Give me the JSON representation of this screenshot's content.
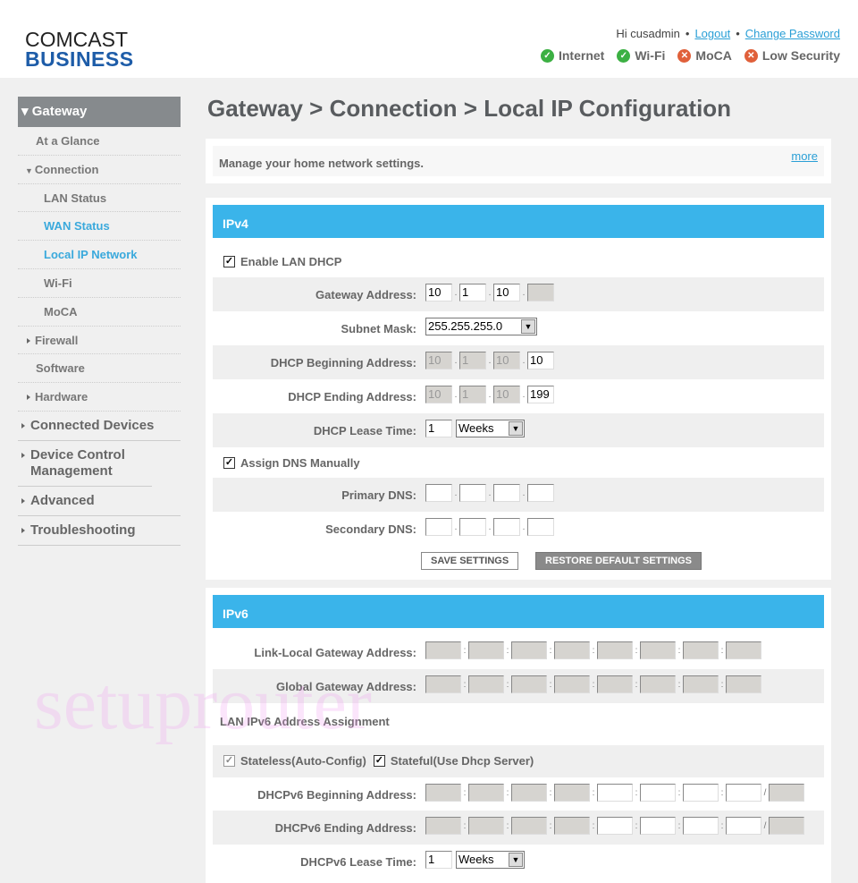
{
  "header": {
    "logo_line1": "COMCAST",
    "logo_line2": "BUSINESS",
    "greeting": "Hi cusadmin",
    "logout": "Logout",
    "change_password": "Change Password",
    "status": [
      {
        "label": "Internet",
        "state": "ok"
      },
      {
        "label": "Wi-Fi",
        "state": "ok"
      },
      {
        "label": "MoCA",
        "state": "error"
      },
      {
        "label": "Low Security",
        "state": "error"
      }
    ]
  },
  "colors": {
    "ok": "#3cb043",
    "error": "#e0603a",
    "accent": "#3ab4ea",
    "sidebar_active": "#868a8d"
  },
  "sidebar": {
    "top": "Gateway",
    "items": [
      {
        "label": "At a Glance",
        "level": 1
      },
      {
        "label": "Connection",
        "level": 1,
        "open": true
      },
      {
        "label": "LAN Status",
        "level": 2
      },
      {
        "label": "WAN Status",
        "level": 2,
        "active": true
      },
      {
        "label": "Local IP Network",
        "level": 2,
        "active": true
      },
      {
        "label": "Wi-Fi",
        "level": 2
      },
      {
        "label": "MoCA",
        "level": 2
      },
      {
        "label": "Firewall",
        "level": 1,
        "collapsed": true
      },
      {
        "label": "Software",
        "level": 1
      },
      {
        "label": "Hardware",
        "level": 1,
        "collapsed": true
      }
    ],
    "sections": [
      "Connected Devices",
      "Device Control Management",
      "Advanced",
      "Troubleshooting"
    ]
  },
  "page": {
    "title": "Gateway > Connection > Local IP Configuration",
    "intro": "Manage your home network settings.",
    "more": "more"
  },
  "ipv4": {
    "title": "IPv4",
    "enable_dhcp": "Enable LAN DHCP",
    "gateway_label": "Gateway Address:",
    "gateway": [
      "10",
      "1",
      "10",
      ""
    ],
    "subnet_label": "Subnet Mask:",
    "subnet": "255.255.255.0",
    "begin_label": "DHCP Beginning Address:",
    "begin": [
      "10",
      "1",
      "10",
      "10"
    ],
    "end_label": "DHCP Ending Address:",
    "end": [
      "10",
      "1",
      "10",
      "199"
    ],
    "lease_label": "DHCP Lease Time:",
    "lease": "1",
    "lease_unit": "Weeks",
    "assign_dns": "Assign DNS Manually",
    "primary_label": "Primary DNS:",
    "secondary_label": "Secondary DNS:",
    "save": "SAVE SETTINGS",
    "restore": "RESTORE DEFAULT SETTINGS"
  },
  "ipv6": {
    "title": "IPv6",
    "link_local_label": "Link-Local Gateway Address:",
    "global_label": "Global Gateway Address:",
    "assignment": "LAN IPv6 Address Assignment",
    "stateless": "Stateless(Auto-Config)",
    "stateful": "Stateful(Use Dhcp Server)",
    "begin_label": "DHCPv6 Beginning Address:",
    "end_label": "DHCPv6 Ending Address:",
    "lease_label": "DHCPv6 Lease Time:",
    "lease": "1",
    "lease_unit": "Weeks"
  },
  "watermark": "setuprouter"
}
